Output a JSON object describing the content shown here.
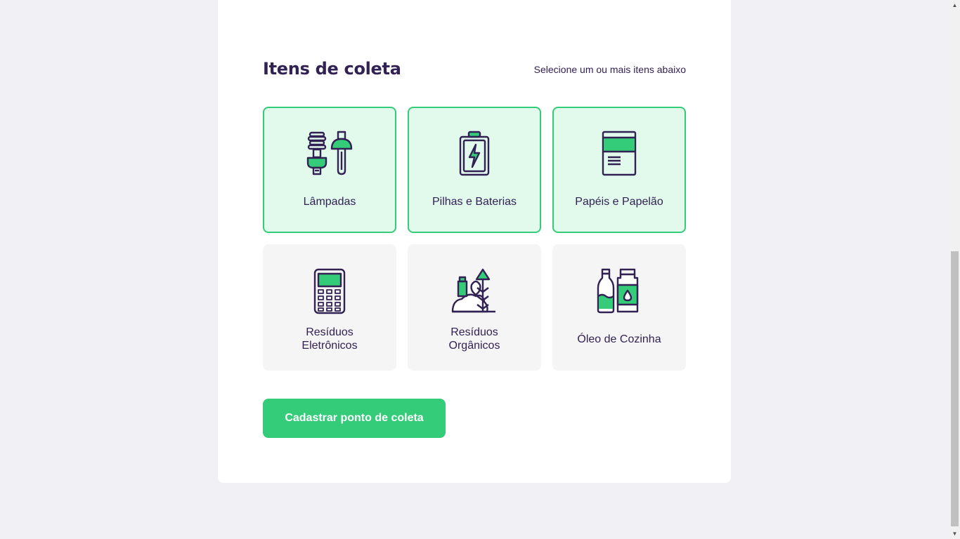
{
  "section": {
    "title": "Itens de coleta",
    "subtitle": "Selecione um ou mais itens abaixo"
  },
  "items": [
    {
      "label": "Lâmpadas",
      "icon": "lamps-icon",
      "selected": true
    },
    {
      "label": "Pilhas e Baterias",
      "icon": "battery-icon",
      "selected": true
    },
    {
      "label": "Papéis e Papelão",
      "icon": "paper-icon",
      "selected": true
    },
    {
      "label": "Resíduos\nEletrônicos",
      "icon": "electronics-icon",
      "selected": false
    },
    {
      "label": "Resíduos\nOrgânicos",
      "icon": "organic-icon",
      "selected": false
    },
    {
      "label": "Óleo de Cozinha",
      "icon": "oil-icon",
      "selected": false
    }
  ],
  "submit_label": "Cadastrar ponto de coleta",
  "colors": {
    "primary": "#34cb79",
    "selected_bg": "#e1faec",
    "title": "#322153",
    "item_bg": "#f5f5f5",
    "page_bg": "#f0f0f5"
  }
}
